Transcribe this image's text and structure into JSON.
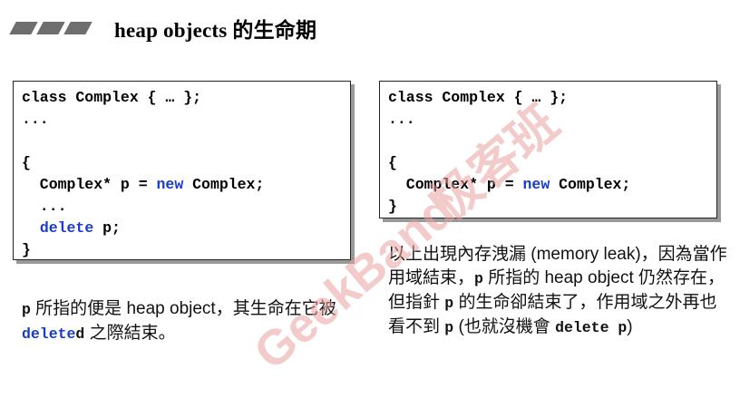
{
  "header": {
    "title": "heap objects 的生命期",
    "decor_icon": "three-parallelogram-bars"
  },
  "left_code": {
    "lines": [
      [
        {
          "t": "class Complex { … };",
          "kw": false
        }
      ],
      [
        {
          "t": "...",
          "kw": false
        }
      ],
      [
        {
          "t": "",
          "kw": false
        }
      ],
      [
        {
          "t": "{",
          "kw": false
        }
      ],
      [
        {
          "t": "  Complex* p = ",
          "kw": false
        },
        {
          "t": "new",
          "kw": true
        },
        {
          "t": " Complex;",
          "kw": false
        }
      ],
      [
        {
          "t": "  ...",
          "kw": false
        }
      ],
      [
        {
          "t": "  ",
          "kw": false
        },
        {
          "t": "delete",
          "kw": true
        },
        {
          "t": " p;",
          "kw": false
        }
      ],
      [
        {
          "t": "}",
          "kw": false
        }
      ]
    ]
  },
  "right_code": {
    "lines": [
      [
        {
          "t": "class Complex { … };",
          "kw": false
        }
      ],
      [
        {
          "t": "...",
          "kw": false
        }
      ],
      [
        {
          "t": "",
          "kw": false
        }
      ],
      [
        {
          "t": "{",
          "kw": false
        }
      ],
      [
        {
          "t": "  Complex* p = ",
          "kw": false
        },
        {
          "t": "new",
          "kw": true
        },
        {
          "t": " Complex;",
          "kw": false
        }
      ],
      [
        {
          "t": "}",
          "kw": false
        }
      ]
    ]
  },
  "left_note": {
    "segments": [
      {
        "t": "p",
        "style": "mono"
      },
      {
        "t": " 所指的便是 heap object，其生命在它被 ",
        "style": "text"
      },
      {
        "t": "delete",
        "style": "mono-blue"
      },
      {
        "t": "d",
        "style": "mono"
      },
      {
        "t": " 之際結束。",
        "style": "text"
      }
    ]
  },
  "right_note": {
    "segments": [
      {
        "t": "以上出現內存洩漏 (memory leak)，因為當作用域結束，",
        "style": "text"
      },
      {
        "t": "p",
        "style": "mono"
      },
      {
        "t": " 所指的 heap object 仍然存在，但指針 ",
        "style": "text"
      },
      {
        "t": "p",
        "style": "mono"
      },
      {
        "t": " 的生命卻結束了，作用域之外再也看不到 ",
        "style": "text"
      },
      {
        "t": "p",
        "style": "mono"
      },
      {
        "t": " (也就沒機會 ",
        "style": "text"
      },
      {
        "t": "delete p",
        "style": "mono"
      },
      {
        "t": ")",
        "style": "text"
      }
    ]
  },
  "watermark": {
    "text_latin": "GeekBand",
    "text_cjk": "极客班",
    "color": "#d9534f"
  },
  "colors": {
    "keyword": "#1a3ccc",
    "box_shadow": "#9a9a9a",
    "decor": "#6e6e6e"
  }
}
